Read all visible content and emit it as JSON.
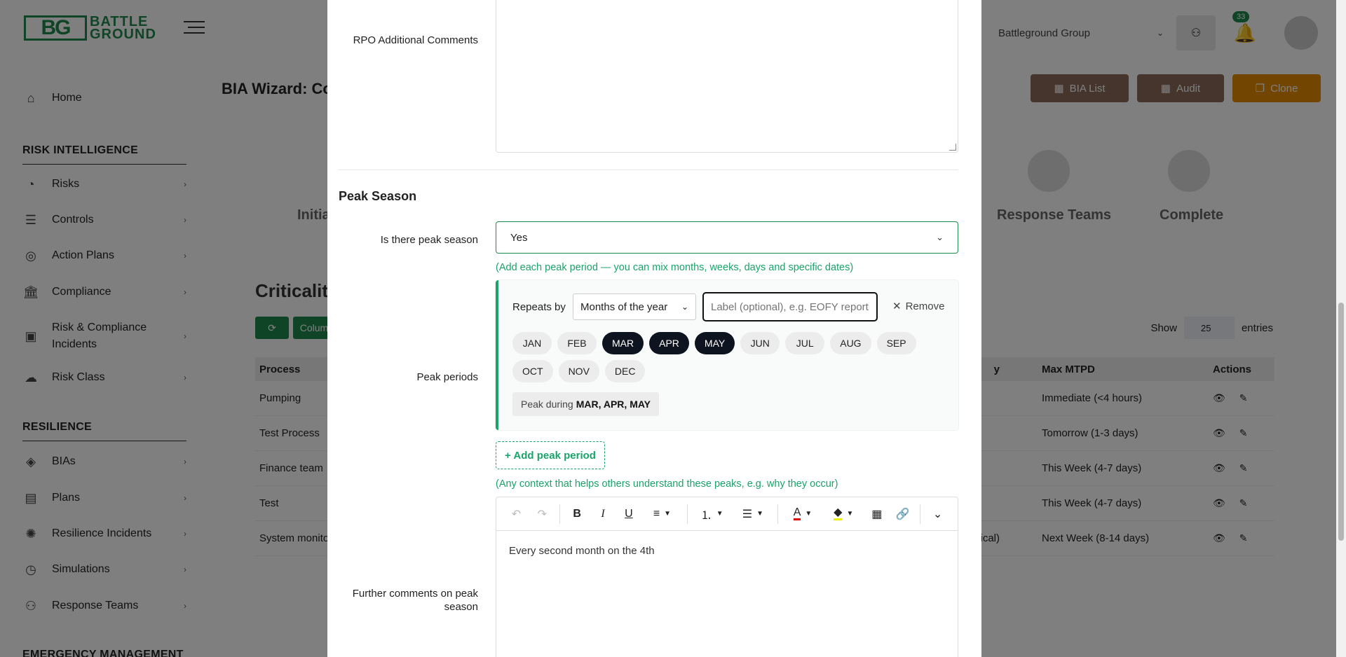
{
  "app": {
    "logo": {
      "mark": "BG",
      "line1": "BATTLE",
      "line2": "GROUND"
    },
    "org": "Battleground Group",
    "notifications": "33",
    "page_title": "BIA Wizard: Co",
    "actions": {
      "bia_list": "BIA List",
      "audit": "Audit",
      "clone": "Clone"
    },
    "sidebar": {
      "home": "Home",
      "risk_section": "RISK INTELLIGENCE",
      "risk_items": [
        "Risks",
        "Controls",
        "Action Plans",
        "Compliance",
        "Risk & Compliance Incidents",
        "Risk Class"
      ],
      "resilience_section": "RESILIENCE",
      "resilience_items": [
        "BIAs",
        "Plans",
        "Resilience Incidents",
        "Simulations",
        "Response Teams"
      ],
      "emergency_section": "EMERGENCY MANAGEMENT"
    },
    "wizard_steps": {
      "initial": "Initia",
      "response": "Response Teams",
      "complete": "Complete"
    },
    "criticality_title": "Criticality",
    "table_controls": {
      "columns": "Colum"
    },
    "show_entries": {
      "show": "Show",
      "value": "25",
      "entries": "entries"
    },
    "table": {
      "headers": {
        "process": "Process",
        "mid": "y",
        "mtpd": "Max MTPD",
        "actions": "Actions"
      },
      "rows": [
        {
          "process": "Pumping",
          "mid": "",
          "mtpd": "Immediate (<4 hours)"
        },
        {
          "process": "Test Process",
          "mid": "",
          "mtpd": "Tomorrow (1-3 days)"
        },
        {
          "process": "Finance team",
          "mid": "",
          "mtpd": "This Week (4-7 days)"
        },
        {
          "process": "Test",
          "mid": "",
          "mtpd": "This Week (4-7 days)"
        },
        {
          "process": "System monito",
          "mid": "itical)",
          "mtpd": "Next Week (8-14 days)"
        }
      ]
    }
  },
  "modal": {
    "rpo_label": "RPO Additional Comments",
    "peak_title": "Peak Season",
    "peak_question": "Is there peak season",
    "peak_value": "Yes",
    "hint_periods": "(Add each peak period — you can mix months, weeks, days and specific dates)",
    "periods_label": "Peak periods",
    "repeats_label": "Repeats by",
    "repeats_value": "Months of the year",
    "label_placeholder": "Label (optional), e.g. EOFY reporting",
    "remove": "Remove",
    "months": [
      {
        "name": "JAN",
        "selected": false
      },
      {
        "name": "FEB",
        "selected": false
      },
      {
        "name": "MAR",
        "selected": true
      },
      {
        "name": "APR",
        "selected": true
      },
      {
        "name": "MAY",
        "selected": true
      },
      {
        "name": "JUN",
        "selected": false
      },
      {
        "name": "JUL",
        "selected": false
      },
      {
        "name": "AUG",
        "selected": false
      },
      {
        "name": "SEP",
        "selected": false
      },
      {
        "name": "OCT",
        "selected": false
      },
      {
        "name": "NOV",
        "selected": false
      },
      {
        "name": "DEC",
        "selected": false
      }
    ],
    "summary_prefix": "Peak during",
    "summary_months": "MAR, APR, MAY",
    "add_period": "+ Add peak period",
    "hint_context": "(Any context that helps others understand these peaks, e.g. why they occur)",
    "comments_label_1": "Further comments on peak",
    "comments_label_2": "season",
    "comments_text": "Every second month on the 4th"
  },
  "colors": {
    "brand": "#1f8a4c",
    "accent": "#1aa36a",
    "selected_chip": "#0e1320",
    "clone": "#e58a00"
  }
}
